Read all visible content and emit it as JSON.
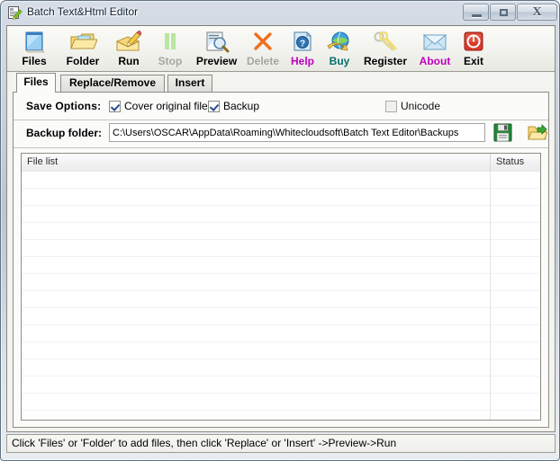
{
  "window": {
    "title": "Batch Text&Html Editor",
    "icon": "app-document-pencil-icon",
    "controls": {
      "minimize": "Minimize",
      "maximize": "Maximize",
      "close": "Close",
      "close_glyph": "X"
    }
  },
  "toolbar": {
    "items": [
      {
        "label": "Files",
        "icon": "files-icon",
        "enabled": true,
        "color": "#000000"
      },
      {
        "label": "Folder",
        "icon": "folder-icon",
        "enabled": true,
        "color": "#000000"
      },
      {
        "label": "Run",
        "icon": "run-pencil-icon",
        "enabled": true,
        "color": "#000000"
      },
      {
        "label": "Stop",
        "icon": "stop-pause-icon",
        "enabled": false,
        "color": "#a6a6a0"
      },
      {
        "label": "Preview",
        "icon": "preview-magnifier-icon",
        "enabled": true,
        "color": "#000000"
      },
      {
        "label": "Delete",
        "icon": "delete-x-icon",
        "enabled": false,
        "color": "#a6a6a0"
      },
      {
        "label": "Help",
        "icon": "help-question-icon",
        "enabled": true,
        "color": "#c000c0"
      },
      {
        "label": "Buy",
        "icon": "buy-globe-icon",
        "enabled": true,
        "color": "#007070"
      },
      {
        "label": "Register",
        "icon": "register-keys-icon",
        "enabled": true,
        "color": "#000000"
      },
      {
        "label": "About",
        "icon": "about-envelope-icon",
        "enabled": true,
        "color": "#c000c0"
      },
      {
        "label": "Exit",
        "icon": "exit-power-icon",
        "enabled": true,
        "color": "#000000"
      }
    ]
  },
  "tabs": [
    {
      "label": "Files",
      "active": true
    },
    {
      "label": "Replace/Remove",
      "active": false
    },
    {
      "label": "Insert",
      "active": false
    }
  ],
  "save_options": {
    "label": "Save Options:",
    "cover_original_file": {
      "label": "Cover original file",
      "checked": true
    },
    "backup": {
      "label": "Backup",
      "checked": true
    },
    "unicode": {
      "label": "Unicode",
      "checked": false
    }
  },
  "backup_folder": {
    "label": "Backup folder:",
    "value": "C:\\Users\\OSCAR\\AppData\\Roaming\\Whitecloudsoft\\Batch Text Editor\\Backups",
    "placeholder": "",
    "save_button_icon": "floppy-save-icon",
    "browse_button_icon": "open-folder-icon"
  },
  "file_list": {
    "columns": [
      {
        "label": "File list"
      },
      {
        "label": "Status"
      }
    ],
    "rows": []
  },
  "statusbar": {
    "text": "Click 'Files' or 'Folder' to add files, then click 'Replace' or 'Insert' ->Preview->Run"
  }
}
